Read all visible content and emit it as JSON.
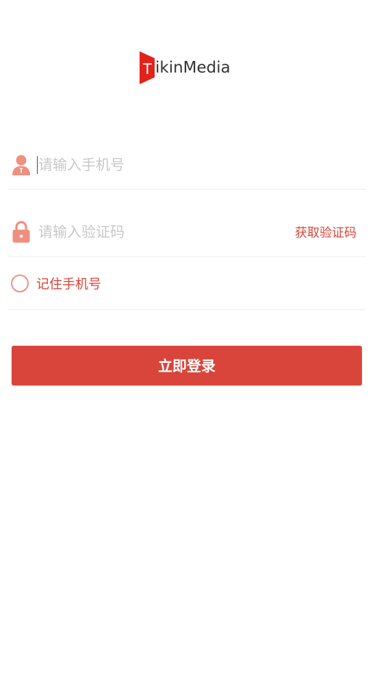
{
  "brand": {
    "logo_letter": "T",
    "logo_text": "ikinMedia",
    "accent_color": "#d9453a",
    "icon_color": "#ef8f7e"
  },
  "form": {
    "phone": {
      "placeholder": "请输入手机号",
      "value": "",
      "icon": "user-icon"
    },
    "code": {
      "placeholder": "请输入验证码",
      "value": "",
      "icon": "lock-icon",
      "get_code_label": "获取验证码"
    },
    "remember": {
      "label": "记住手机号",
      "checked": false
    },
    "submit_label": "立即登录"
  }
}
